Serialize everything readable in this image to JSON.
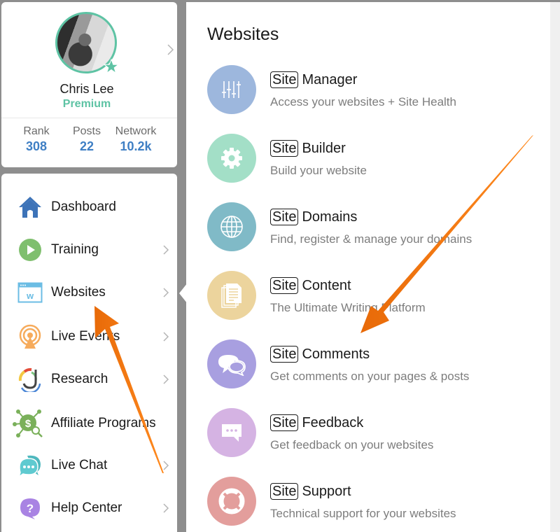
{
  "profile": {
    "name": "Chris Lee",
    "tier": "Premium",
    "stats": [
      {
        "label": "Rank",
        "value": "308"
      },
      {
        "label": "Posts",
        "value": "22"
      },
      {
        "label": "Network",
        "value": "10.2k"
      }
    ]
  },
  "nav": {
    "items": [
      {
        "label": "Dashboard",
        "icon": "home-icon",
        "has_chevron": false
      },
      {
        "label": "Training",
        "icon": "play-icon",
        "has_chevron": true
      },
      {
        "label": "Websites",
        "icon": "website-window-icon",
        "has_chevron": true,
        "active": true
      },
      {
        "label": "Live Events",
        "icon": "broadcast-icon",
        "has_chevron": true
      },
      {
        "label": "Research",
        "icon": "research-icon",
        "has_chevron": true
      },
      {
        "label": "Affiliate Programs",
        "icon": "affiliate-network-icon",
        "has_chevron": false
      },
      {
        "label": "Live Chat",
        "icon": "chat-bubbles-icon",
        "has_chevron": true
      },
      {
        "label": "Help Center",
        "icon": "help-question-icon",
        "has_chevron": true
      }
    ]
  },
  "panel": {
    "title": "Websites",
    "badge": "Site",
    "items": [
      {
        "name": "Manager",
        "desc": "Access your websites + Site Health",
        "icon": "sliders-icon",
        "color": "#9db7dd"
      },
      {
        "name": "Builder",
        "desc": "Build your website",
        "icon": "gear-icon",
        "color": "#a3dfc7"
      },
      {
        "name": "Domains",
        "desc": "Find, register & manage your domains",
        "icon": "globe-icon",
        "color": "#80bac7"
      },
      {
        "name": "Content",
        "desc": "The Ultimate Writing Platform",
        "icon": "documents-icon",
        "color": "#ecd49d"
      },
      {
        "name": "Comments",
        "desc": "Get comments on your pages & posts",
        "icon": "comments-icon",
        "color": "#a89fe0"
      },
      {
        "name": "Feedback",
        "desc": "Get feedback on your websites",
        "icon": "feedback-bubble-icon",
        "color": "#d5b3e3"
      },
      {
        "name": "Support",
        "desc": "Technical support for your websites",
        "icon": "lifebuoy-icon",
        "color": "#e39e9c"
      }
    ]
  },
  "colors": {
    "accent_green": "#5ec3a4",
    "stat_blue": "#3f7fc4",
    "annotation_orange": "#f47a12"
  }
}
